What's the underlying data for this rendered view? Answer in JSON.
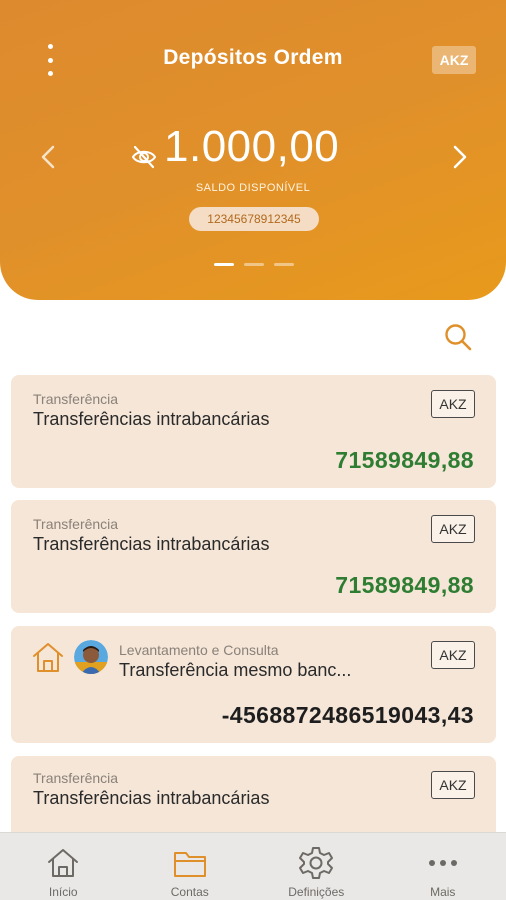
{
  "header": {
    "title": "Depósitos Ordem",
    "currency": "AKZ",
    "balance": "1.000,00",
    "balance_label": "SALDO DISPONÍVEL",
    "account_number": "12345678912345",
    "carousel_pages": 3,
    "carousel_active": 1
  },
  "colors": {
    "brand_orange": "#e0902a",
    "card_bg": "#f5e6d8",
    "positive": "#2e7d32",
    "negative": "#1e1e1e"
  },
  "transactions": [
    {
      "kind": "Transferência",
      "description": "Transferências intrabancárias",
      "currency": "AKZ",
      "amount": "71589849,88",
      "sign": "positive"
    },
    {
      "kind": "Transferência",
      "description": "Transferências intrabancárias",
      "currency": "AKZ",
      "amount": "71589849,88",
      "sign": "positive"
    },
    {
      "kind": "Levantamento e Consulta",
      "description": "Transferência mesmo banc...",
      "currency": "AKZ",
      "amount": "-4568872486519043,43",
      "sign": "negative",
      "icons": [
        "home-icon",
        "avatar"
      ]
    },
    {
      "kind": "Transferência",
      "description": "Transferências intrabancárias",
      "currency": "AKZ",
      "amount": "",
      "sign": "positive"
    }
  ],
  "bottom_nav": [
    {
      "label": "Início",
      "icon": "home-icon"
    },
    {
      "label": "Contas",
      "icon": "folder-icon",
      "active": true
    },
    {
      "label": "Definições",
      "icon": "gear-icon"
    },
    {
      "label": "Mais",
      "icon": "more-dots-icon"
    }
  ]
}
